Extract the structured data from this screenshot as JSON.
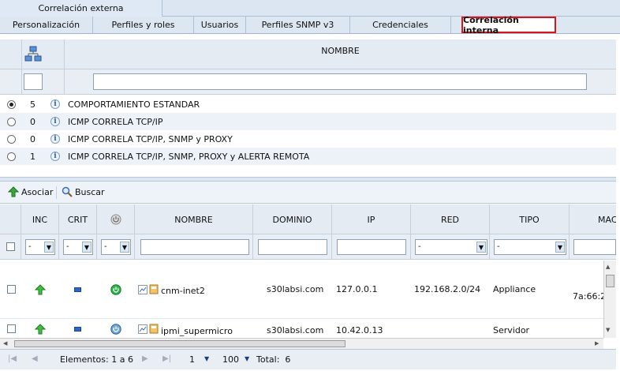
{
  "tabs_top": {
    "external": "Correlación externa"
  },
  "tabs": [
    {
      "label": "Personalización"
    },
    {
      "label": "Perfiles y roles"
    },
    {
      "label": "Usuarios"
    },
    {
      "label": "Perfiles SNMP v3"
    },
    {
      "label": "Credenciales"
    },
    {
      "label": "Correlación interna"
    }
  ],
  "upper_grid": {
    "header_nombre": "NOMBRE",
    "rows": [
      {
        "count": "5",
        "name": "COMPORTAMIENTO ESTANDAR",
        "selected": true
      },
      {
        "count": "0",
        "name": "ICMP CORRELA TCP/IP",
        "selected": false
      },
      {
        "count": "0",
        "name": "ICMP CORRELA TCP/IP, SNMP y PROXY",
        "selected": false
      },
      {
        "count": "1",
        "name": "ICMP CORRELA TCP/IP, SNMP, PROXY y ALERTA REMOTA",
        "selected": false
      }
    ]
  },
  "toolbar": {
    "associate": "Asociar",
    "search": "Buscar"
  },
  "lower_grid": {
    "headers": {
      "inc": "INC",
      "crit": "CRIT",
      "nombre": "NOMBRE",
      "dominio": "DOMINIO",
      "ip": "IP",
      "red": "RED",
      "tipo": "TIPO",
      "mac": "MAC"
    },
    "filters": {
      "inc": "-",
      "crit": "-",
      "status": "-",
      "red": "-",
      "tipo": "-"
    },
    "rows": [
      {
        "nombre": "cnm-inet2",
        "dominio": "s30labsi.com",
        "ip": "127.0.0.1",
        "red": "192.168.2.0/24",
        "tipo": "Appliance",
        "mac": "7a:66:2"
      },
      {
        "nombre": "ipmi_supermicro",
        "dominio": "s30labsi.com",
        "ip": "10.42.0.13",
        "red": "",
        "tipo": "Servidor",
        "mac": ""
      }
    ]
  },
  "pager": {
    "elements": "Elementos: 1 a 6",
    "page": "1",
    "per_page": "100",
    "total": "Total:  6"
  },
  "colors": {
    "active_tab_border": "#d9141a",
    "header_bg": "#e4ebf3",
    "alt_row": "#edf2f8"
  }
}
